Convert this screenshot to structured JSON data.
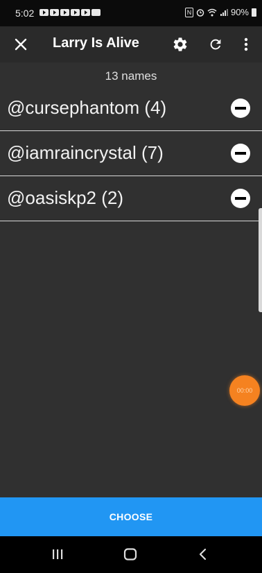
{
  "status_bar": {
    "time": "5:02",
    "battery": "90%"
  },
  "app_bar": {
    "title": "Larry Is Alive"
  },
  "list": {
    "count_label": "13 names",
    "items": [
      {
        "label": "@cursephantom (4)"
      },
      {
        "label": "@iamraincrystal (7)"
      },
      {
        "label": "@oasiskp2 (2)"
      }
    ]
  },
  "timer": {
    "value": "00:00"
  },
  "footer": {
    "choose_label": "CHOOSE"
  },
  "colors": {
    "accent": "#2196f3",
    "timer": "#f58220",
    "background": "#303030"
  },
  "icons": [
    "close-icon",
    "gear-icon",
    "refresh-icon",
    "more-vert-icon",
    "remove-icon",
    "recents-icon",
    "home-icon",
    "back-icon"
  ]
}
